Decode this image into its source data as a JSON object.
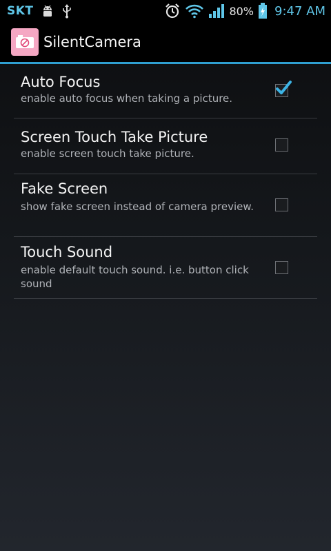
{
  "status_bar": {
    "carrier": "SKT",
    "battery_percent": "80%",
    "time": "9:47 AM",
    "icons": [
      "android-debug-icon",
      "usb-icon",
      "alarm-icon",
      "wifi-icon",
      "signal-icon",
      "battery-charging-icon"
    ],
    "accent_color": "#5fc6e8"
  },
  "action_bar": {
    "title": "SilentCamera",
    "app_icon": "camera-mute-icon",
    "divider_color": "#2f9fd0"
  },
  "preferences": [
    {
      "title": "Auto Focus",
      "summary": "enable auto focus when taking a picture.",
      "checked": true
    },
    {
      "title": "Screen Touch Take Picture",
      "summary": "enable screen touch take picture.",
      "checked": false
    },
    {
      "title": "Fake Screen",
      "summary": "show fake screen instead of camera preview.",
      "checked": false
    },
    {
      "title": "Touch Sound",
      "summary": "enable default touch sound. i.e. button click sound",
      "checked": false
    }
  ]
}
